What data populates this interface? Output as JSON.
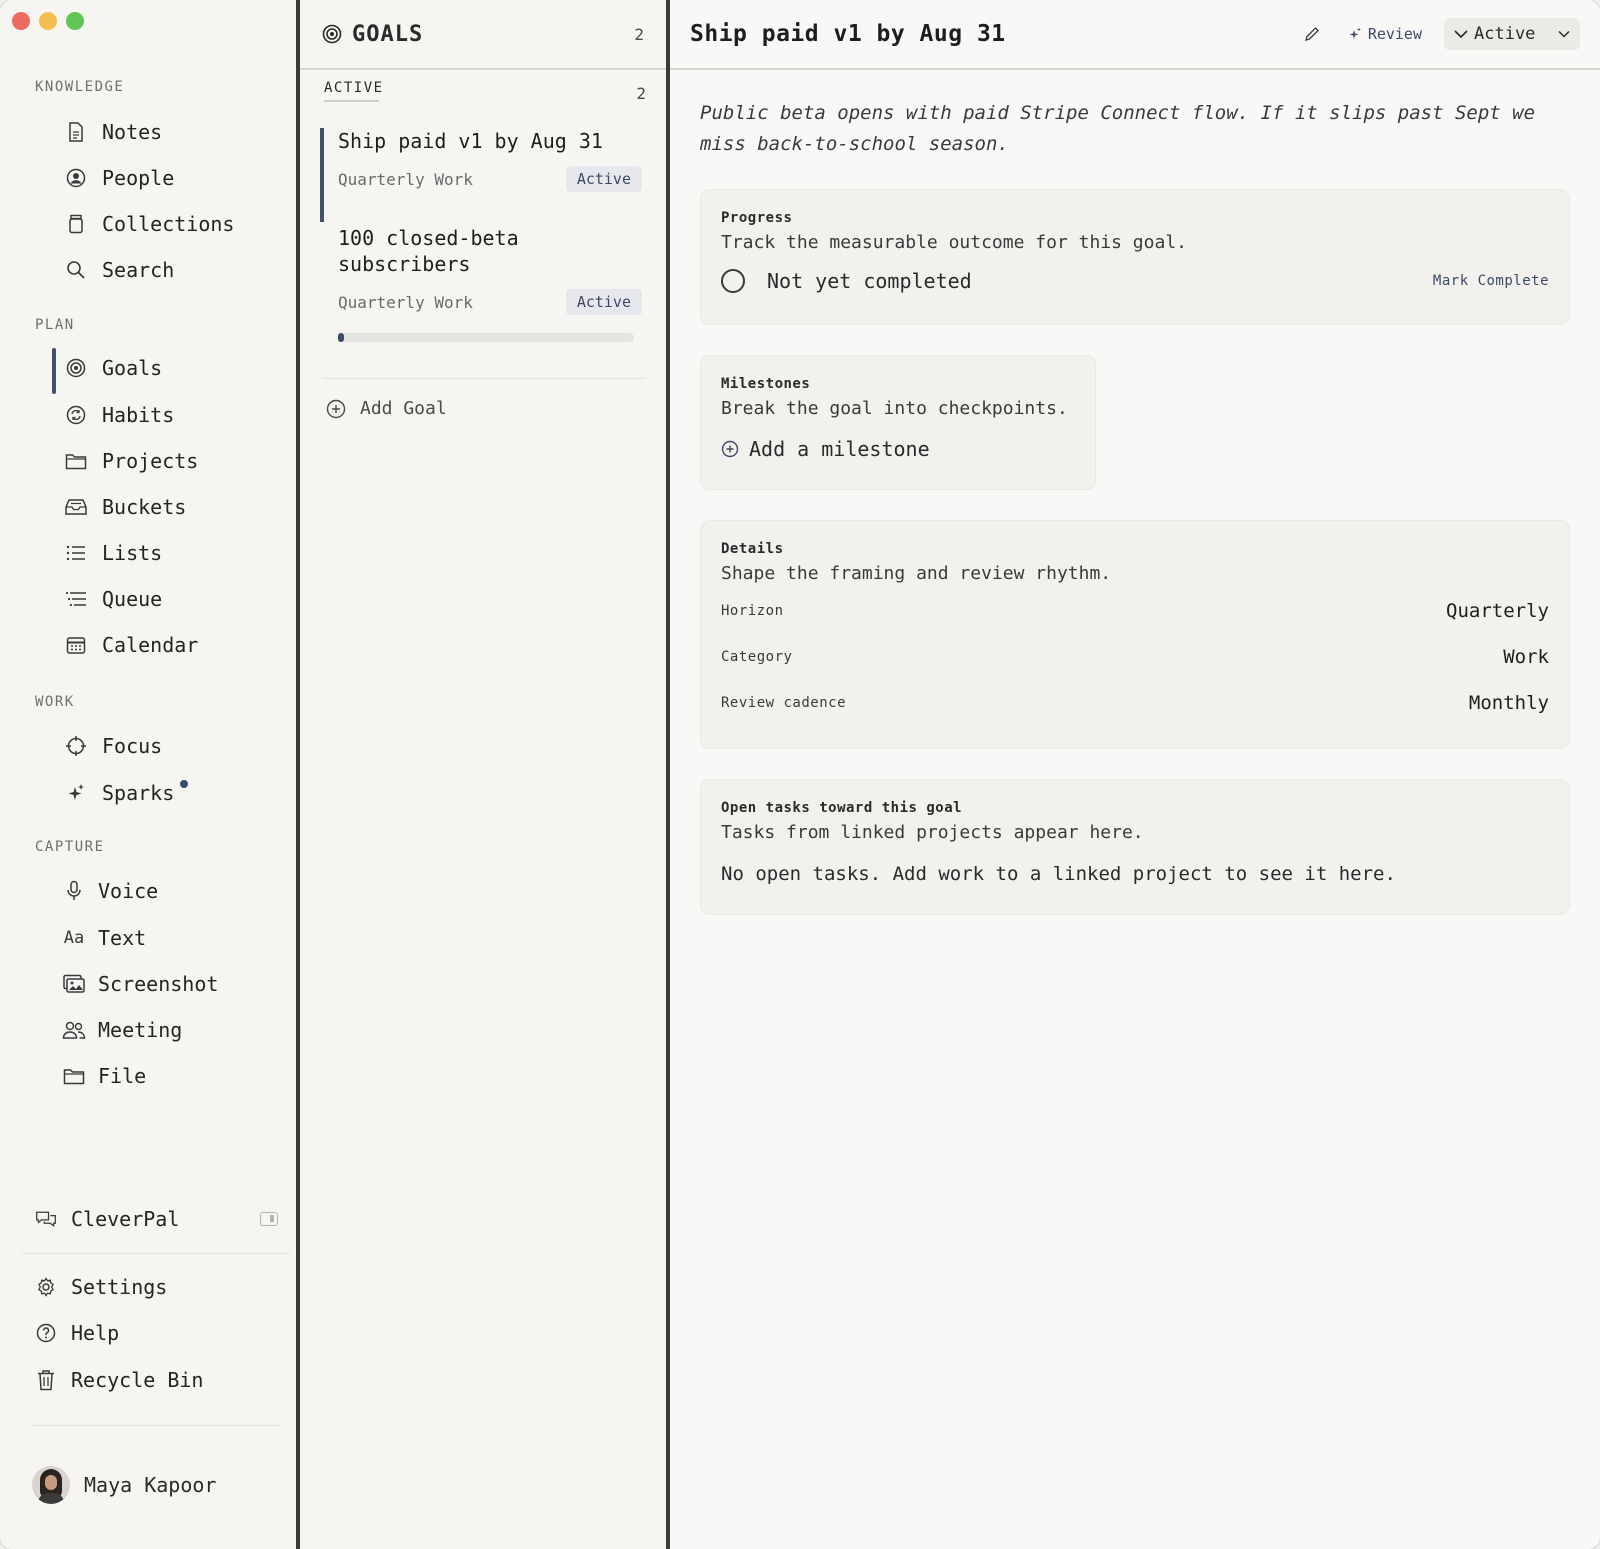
{
  "sidebar": {
    "sections": {
      "knowledge": "KNOWLEDGE",
      "plan": "PLAN",
      "work": "WORK",
      "capture": "CAPTURE"
    },
    "knowledge_items": [
      {
        "label": "Notes",
        "icon": "note-icon"
      },
      {
        "label": "People",
        "icon": "person-icon"
      },
      {
        "label": "Collections",
        "icon": "jar-icon"
      },
      {
        "label": "Search",
        "icon": "search-icon"
      }
    ],
    "plan_items": [
      {
        "label": "Goals",
        "icon": "target-icon",
        "active": true
      },
      {
        "label": "Habits",
        "icon": "repeat-icon"
      },
      {
        "label": "Projects",
        "icon": "folder-icon"
      },
      {
        "label": "Buckets",
        "icon": "inbox-icon"
      },
      {
        "label": "Lists",
        "icon": "list-icon"
      },
      {
        "label": "Queue",
        "icon": "queue-icon"
      },
      {
        "label": "Calendar",
        "icon": "calendar-icon"
      }
    ],
    "work_items": [
      {
        "label": "Focus",
        "icon": "crosshair-icon"
      },
      {
        "label": "Sparks",
        "icon": "sparkle-icon",
        "unread_dot": true
      }
    ],
    "capture_items": [
      {
        "label": "Voice",
        "icon": "microphone-icon"
      },
      {
        "label": "Text",
        "icon": "text-icon",
        "glyph": "Aa"
      },
      {
        "label": "Screenshot",
        "icon": "screenshot-icon"
      },
      {
        "label": "Meeting",
        "icon": "people-icon"
      },
      {
        "label": "File",
        "icon": "folder-icon"
      }
    ],
    "assistant": "CleverPal",
    "settings": "Settings",
    "help": "Help",
    "recycle_bin": "Recycle Bin",
    "user_name": "Maya Kapoor"
  },
  "goals_list": {
    "title": "GOALS",
    "count": "2",
    "group_label": "ACTIVE",
    "group_count": "2",
    "goals": [
      {
        "title": "Ship paid v1 by Aug 31",
        "category": "Quarterly Work",
        "status": "Active",
        "selected": true
      },
      {
        "title": "100 closed-beta subscribers",
        "category": "Quarterly Work",
        "status": "Active",
        "progress_fraction": 0.02
      }
    ],
    "add_goal": "Add Goal"
  },
  "detail": {
    "title": "Ship paid v1 by Aug 31",
    "review_label": "Review",
    "status_value": "Active",
    "description": "Public beta opens with paid Stripe Connect flow. If it slips past Sept we miss back-to-school season.",
    "progress": {
      "label": "Progress",
      "subtitle": "Track the measurable outcome for this goal.",
      "state": "Not yet completed",
      "action": "Mark Complete"
    },
    "milestones": {
      "label": "Milestones",
      "subtitle": "Break the goal into checkpoints.",
      "add": "Add a milestone"
    },
    "details": {
      "label": "Details",
      "subtitle": "Shape the framing and review rhythm.",
      "horizon_key": "Horizon",
      "horizon_value": "Quarterly",
      "category_key": "Category",
      "category_value": "Work",
      "cadence_key": "Review cadence",
      "cadence_value": "Monthly"
    },
    "tasks": {
      "label": "Open tasks toward this goal",
      "subtitle": "Tasks from linked projects appear here.",
      "empty": "No open tasks. Add work to a linked project to see it here."
    }
  },
  "colors": {
    "accent": "#45506e",
    "badge_bg": "#e6e8ee",
    "badge_text": "#3c4a68"
  }
}
